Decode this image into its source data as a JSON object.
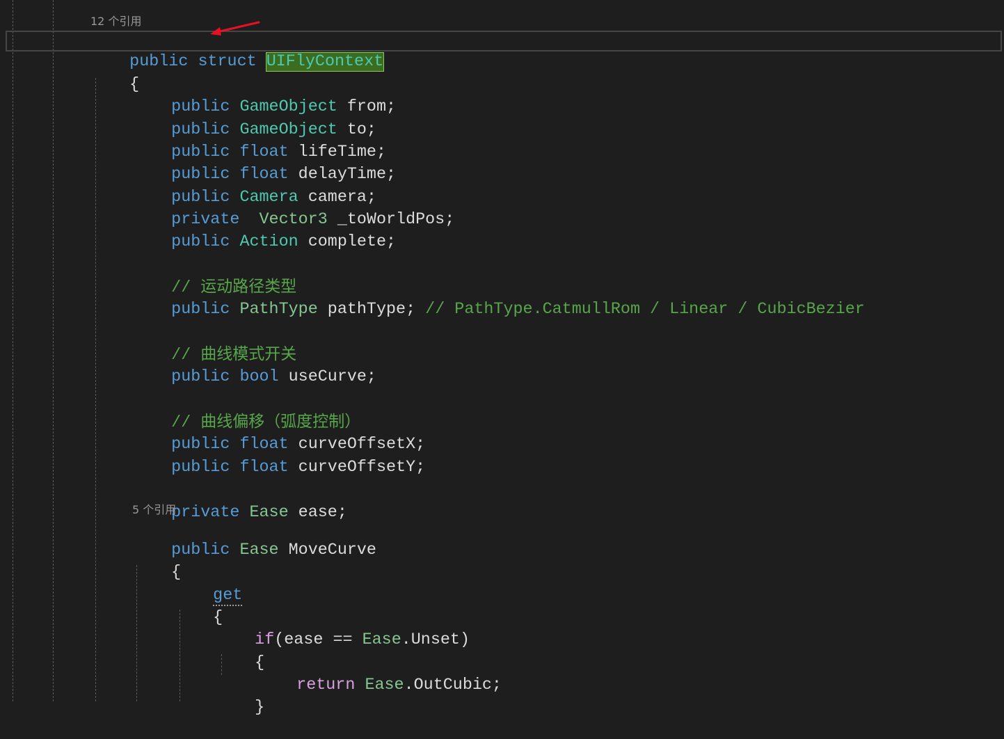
{
  "editor": {
    "codelens_struct": "12 个引用",
    "codelens_property": "5 个引用",
    "lines": {
      "struct_decl": {
        "kw1": "public",
        "kw2": "struct",
        "name": "UIFlyContext"
      },
      "open_brace_1": "{",
      "f_from": {
        "mod": "public",
        "type": "GameObject",
        "rest": "from;"
      },
      "f_to": {
        "mod": "public",
        "type": "GameObject",
        "rest": "to;"
      },
      "f_lifetime": {
        "mod": "public",
        "type": "float",
        "rest": "lifeTime;"
      },
      "f_delaytime": {
        "mod": "public",
        "type": "float",
        "rest": "delayTime;"
      },
      "f_camera": {
        "mod": "public",
        "type": "Camera",
        "rest": "camera;"
      },
      "f_toworld": {
        "mod": "private",
        "type": "Vector3",
        "rest": "_toWorldPos;"
      },
      "f_complete": {
        "mod": "public",
        "type": "Action",
        "rest": "complete;"
      },
      "c_pathtype": {
        "slashes": "//",
        "text": "运动路径类型"
      },
      "f_pathtype": {
        "mod": "public",
        "type": "PathType",
        "rest": "pathType;",
        "comment": "// PathType.CatmullRom / Linear / CubicBezier"
      },
      "c_curve": {
        "slashes": "//",
        "text": "曲线模式开关"
      },
      "f_usecurve": {
        "mod": "public",
        "type": "bool",
        "rest": "useCurve;"
      },
      "c_offset": {
        "slashes": "//",
        "text": "曲线偏移（弧度控制）"
      },
      "f_offx": {
        "mod": "public",
        "type": "float",
        "rest": "curveOffsetX;"
      },
      "f_offy": {
        "mod": "public",
        "type": "float",
        "rest": "curveOffsetY;"
      },
      "f_ease": {
        "mod": "private",
        "type": "Ease",
        "rest": "ease;"
      },
      "p_movecurve": {
        "mod": "public",
        "type": "Ease",
        "rest": "MoveCurve"
      },
      "open_brace_2": "{",
      "get_kw": "get",
      "open_brace_3": "{",
      "if_line": {
        "kw": "if",
        "p1": "(ease == ",
        "type": "Ease",
        "p2": ".Unset)"
      },
      "open_brace_4": "{",
      "return_line": {
        "kw": "return",
        "type": "Ease",
        "rest": ".OutCubic;"
      },
      "close_brace_4": "}"
    }
  },
  "annotation": {
    "color": "#e81123"
  }
}
